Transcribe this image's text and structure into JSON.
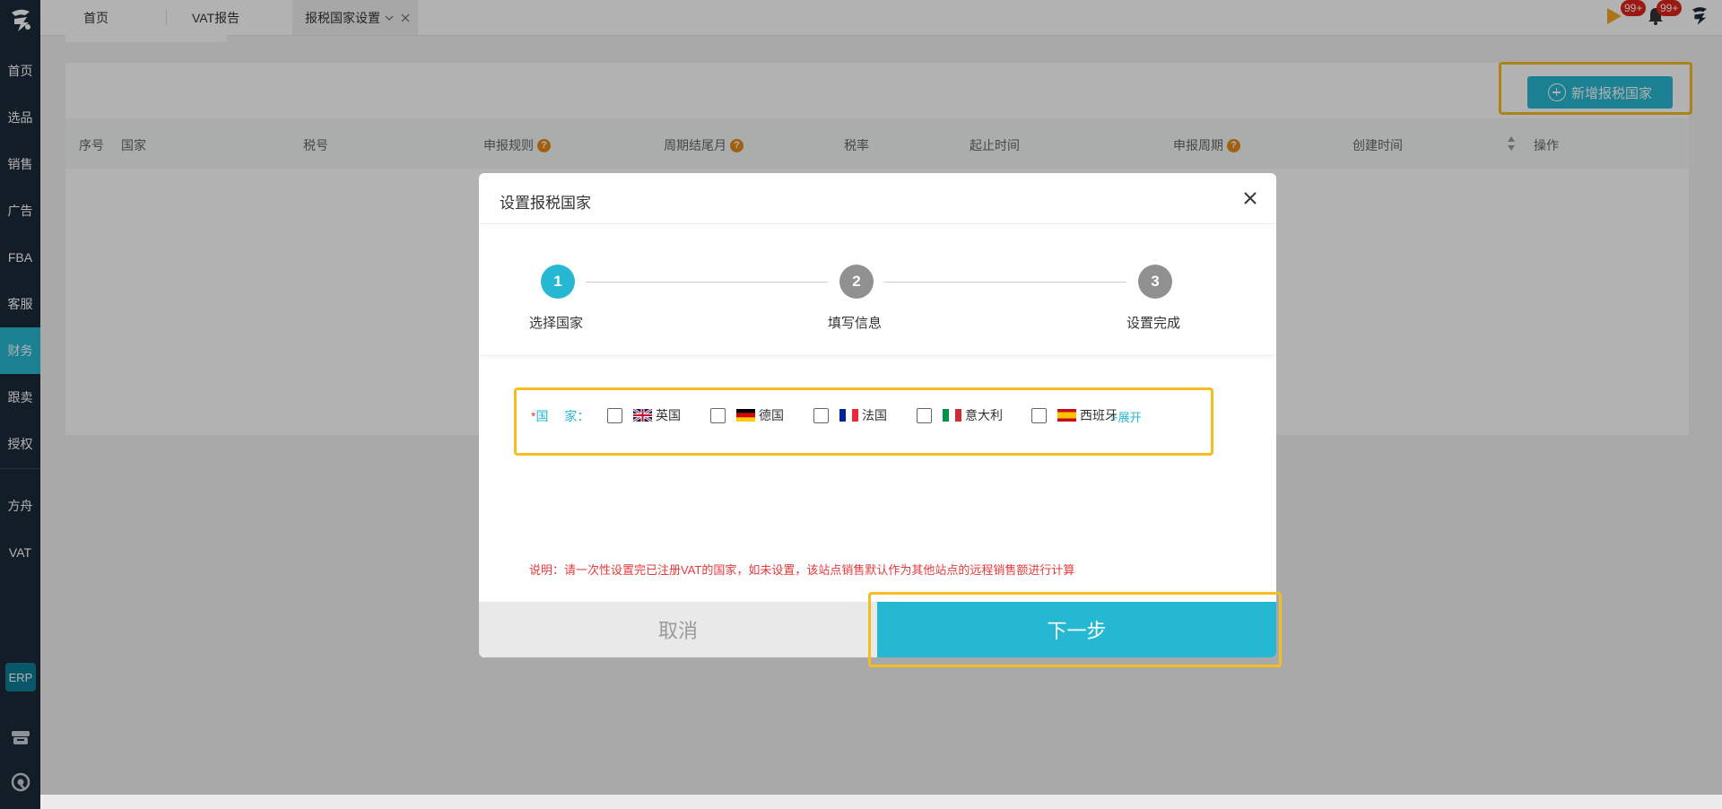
{
  "sidebar": {
    "items": [
      {
        "label": "首页"
      },
      {
        "label": "选品"
      },
      {
        "label": "销售"
      },
      {
        "label": "广告"
      },
      {
        "label": "FBA"
      },
      {
        "label": "客服"
      },
      {
        "label": "财务"
      },
      {
        "label": "跟卖"
      },
      {
        "label": "授权"
      },
      {
        "label": "方舟"
      },
      {
        "label": "VAT"
      }
    ],
    "active": "财务",
    "erp_label": "ERP"
  },
  "topbar": {
    "tabs": [
      {
        "label": "首页"
      },
      {
        "label": "VAT报告"
      },
      {
        "label": "报税国家设置"
      }
    ],
    "badge1": "99+",
    "badge2": "99+"
  },
  "page": {
    "add_button_label": "新增报税国家",
    "columns": [
      "序号",
      "国家",
      "税号",
      "申报规则",
      "周期结尾月",
      "税率",
      "起止时间",
      "申报周期",
      "创建时间",
      "操作"
    ]
  },
  "modal": {
    "title": "设置报税国家",
    "steps": [
      {
        "num": "1",
        "label": "选择国家",
        "state": "active"
      },
      {
        "num": "2",
        "label": "填写信息",
        "state": "pending"
      },
      {
        "num": "3",
        "label": "设置完成",
        "state": "pending"
      }
    ],
    "country_label_required": "*",
    "country_label": "国　 家：",
    "countries": [
      {
        "name": "英国",
        "flag": "uk-flag-icon"
      },
      {
        "name": "德国",
        "flag": "de-flag-icon"
      },
      {
        "name": "法国",
        "flag": "fr-flag-icon"
      },
      {
        "name": "意大利",
        "flag": "it-flag-icon"
      },
      {
        "name": "西班牙",
        "flag": "es-flag-icon"
      }
    ],
    "expand_label": "+展开",
    "note": "说明：请一次性设置完已注册VAT的国家，如未设置，该站点销售默认作为其他站点的远程销售额进行计算",
    "cancel_label": "取消",
    "next_label": "下一步"
  },
  "colors": {
    "accent": "#26b8d2",
    "sidebar_bg": "#1b2a3a",
    "highlight": "#f5bd1f",
    "danger": "#e4393c"
  }
}
